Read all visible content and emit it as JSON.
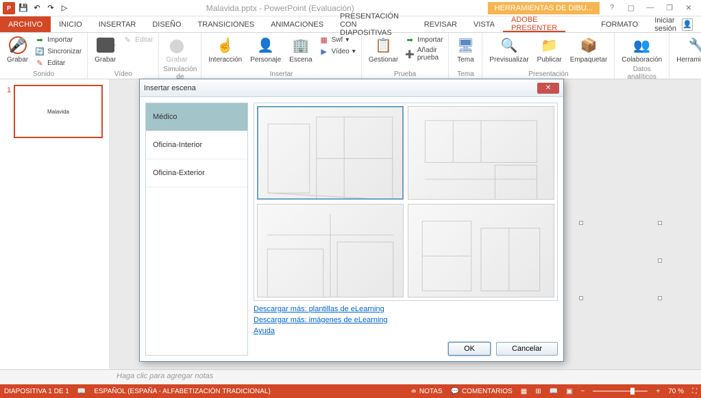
{
  "titlebar": {
    "app_icon": "P",
    "title": "Malavida.pptx - PowerPoint (Evaluación)",
    "tool_tab": "HERRAMIENTAS DE DIBU...",
    "help": "?",
    "ribbon_opts": "▢",
    "minimize": "—",
    "restore": "❐",
    "close": "✕"
  },
  "qat": {
    "save": "💾",
    "undo": "↶",
    "redo": "↷",
    "start": "▷"
  },
  "tabs": {
    "file": "ARCHIVO",
    "items": [
      "INICIO",
      "INSERTAR",
      "DISEÑO",
      "TRANSICIONES",
      "ANIMACIONES",
      "PRESENTACIÓN CON DIAPOSITIVAS",
      "REVISAR",
      "VISTA",
      "ADOBE PRESENTER"
    ],
    "format": "FORMATO",
    "active": "ADOBE PRESENTER",
    "signin": "Iniciar sesión"
  },
  "ribbon": {
    "sonido": {
      "label": "Sonido",
      "grabar": "Grabar",
      "importar": "Importar",
      "sincronizar": "Sincronizar",
      "editar": "Editar"
    },
    "video": {
      "label": "Vídeo",
      "grabar": "Grabar",
      "editar": "Editar"
    },
    "sim": {
      "label": "Simulación de aplicación",
      "grabar": "Grabar"
    },
    "insertar": {
      "label": "Insertar",
      "interaccion": "Interacción",
      "personaje": "Personaje",
      "escena": "Escena",
      "swf": "Swf",
      "video": "Vídeo"
    },
    "prueba": {
      "label": "Prueba",
      "gestionar": "Gestionar",
      "importar": "Importar",
      "anadir": "Añadir prueba"
    },
    "tema": {
      "label": "Tema",
      "tema": "Tema"
    },
    "presentacion": {
      "label": "Presentación",
      "previsualizar": "Previsualizar",
      "publicar": "Publicar",
      "empaquetar": "Empaquetar"
    },
    "datos": {
      "label": "Datos analíticos",
      "colaboracion": "Colaboración"
    },
    "herramientas": {
      "herramientas": "Herramientas"
    }
  },
  "slides": {
    "num": "1",
    "thumb_title": "Malavida",
    "thumb_sub": ""
  },
  "notes": {
    "placeholder": "Haga clic para agregar notas"
  },
  "statusbar": {
    "slide_info": "DIAPOSITIVA 1 DE 1",
    "lang": "ESPAÑOL (ESPAÑA - ALFABETIZACIÓN TRADICIONAL)",
    "notes": "NOTAS",
    "comments": "COMENTARIOS",
    "zoom": "70 %"
  },
  "dialog": {
    "title": "Insertar escena",
    "categories": [
      "Médico",
      "Oficina-Interior",
      "Oficina-Exterior"
    ],
    "selected_cat": 0,
    "link1": "Descargar más: plantillas de eLearning",
    "link2": "Descargar más: imágenes de eLearning",
    "help": "Ayuda",
    "ok": "OK",
    "cancel": "Cancelar"
  }
}
